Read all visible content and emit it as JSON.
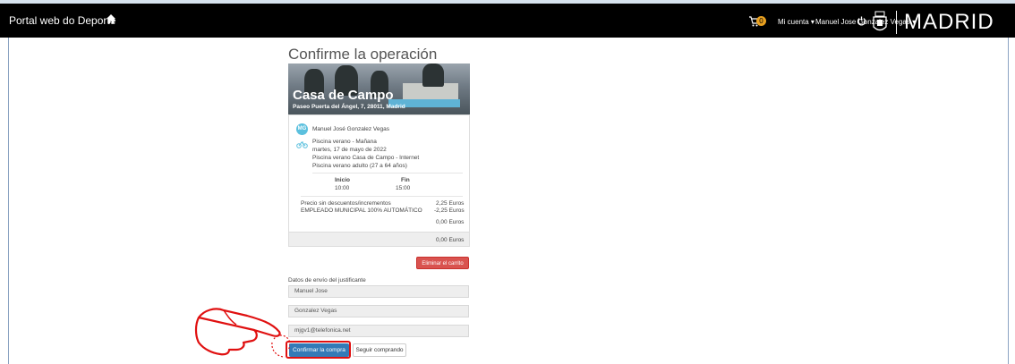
{
  "navbar": {
    "brand": "Portal web do Deporte",
    "cart_count": "0",
    "my_account": "Mi cuenta ▾",
    "user_menu": "Manuel Jose Gonzalez Vegas ▾",
    "city_logo": "MADRID"
  },
  "page": {
    "title": "Confirme la operación"
  },
  "venue": {
    "name": "Casa de Campo",
    "address": "Paseo Puerta del Ángel, 7, 28011, Madrid"
  },
  "booking": {
    "avatar_initials": "MG",
    "user_name": "Manuel José Gonzalez Vegas",
    "activity": "Piscina verano - Mañana",
    "date": "martes, 17 de mayo de 2022",
    "facility": "Piscina verano Casa de Campo - Internet",
    "ticket": "Piscina verano adulto (27 a 64 años)",
    "start_label": "Inicio",
    "start_time": "10:00",
    "end_label": "Fin",
    "end_time": "15:00",
    "price_label": "Precio sin descuentos/incrementos",
    "price_value": "2,25 Euros",
    "discount_label": "EMPLEADO MUNICIPAL 100% AUTOMÁTICO",
    "discount_value": "-2,25 Euros",
    "subtotal": "0,00 Euros",
    "total": "0,00 Euros"
  },
  "actions": {
    "remove_cart": "Eliminar el carrito",
    "confirm": "Confirmar la compra",
    "continue": "Seguir comprando"
  },
  "receipt": {
    "section_label": "Datos de envío del justificante",
    "first_name": "Manuel Jose",
    "last_name": "Gonzalez Vegas",
    "email": "mjgv1@telefonica.net"
  },
  "colors": {
    "navbar": "#000000",
    "primary": "#337ab7",
    "danger": "#d9534f",
    "highlight": "#e01010"
  }
}
